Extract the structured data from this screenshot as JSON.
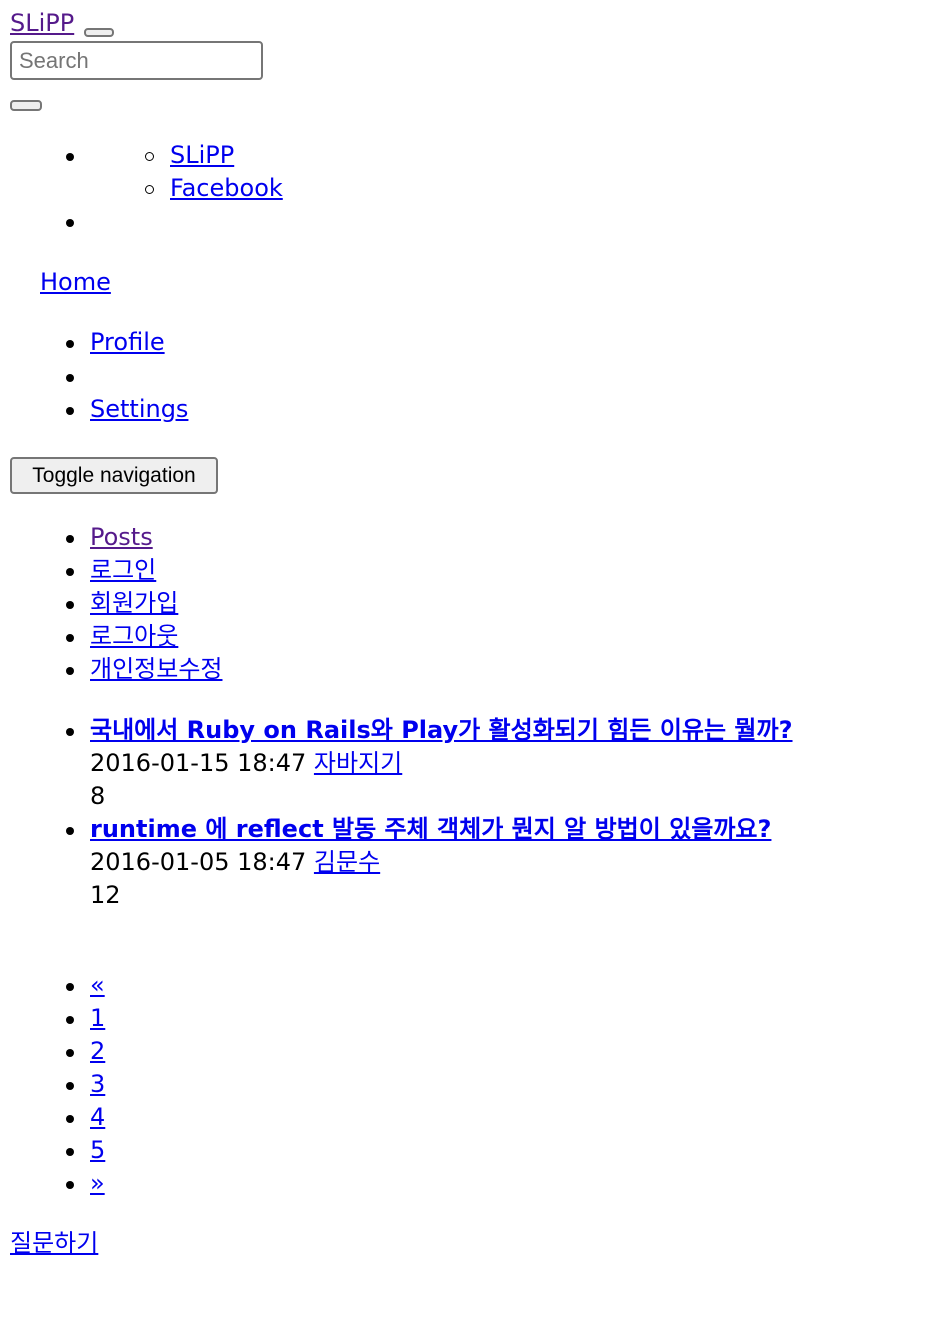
{
  "navbar": {
    "brand": "SLiPP",
    "search_placeholder": "Search",
    "social_links": [
      "SLiPP",
      "Facebook"
    ],
    "home_link": "Home",
    "user_menu": {
      "profile": "Profile",
      "settings": "Settings"
    },
    "toggle_label": "Toggle navigation",
    "main_menu": [
      "Posts",
      "로그인",
      "회원가입",
      "로그아웃",
      "개인정보수정"
    ]
  },
  "posts": [
    {
      "title": "국내에서 Ruby on Rails와 Play가 활성화되기 힘든 이유는 뭘까?",
      "date": "2016-01-15 18:47",
      "author": "자바지기",
      "count": "8"
    },
    {
      "title": "runtime 에 reflect 발동 주체 객체가 뭔지 알 방법이 있을까요?",
      "date": "2016-01-05 18:47",
      "author": "김문수",
      "count": "12"
    }
  ],
  "pagination": {
    "prev": "«",
    "pages": [
      "1",
      "2",
      "3",
      "4",
      "5"
    ],
    "next": "»"
  },
  "ask_link": "질문하기",
  "colors": {
    "link": "#0000ee",
    "visited": "#551a8b"
  }
}
